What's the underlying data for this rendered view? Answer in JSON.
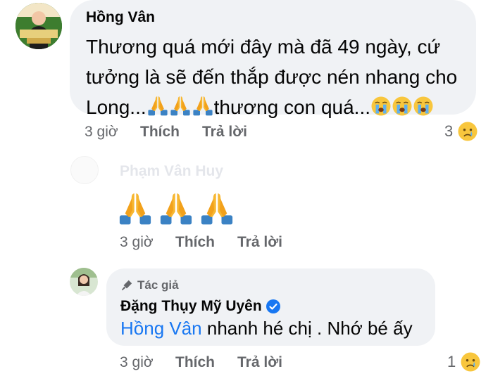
{
  "comments": [
    {
      "author": "Hồng Vân",
      "text_parts": [
        "Thương quá mới đây mà đã 49 ngày, cứ",
        "tưởng là sẽ đến thắp được nén nhang cho",
        "Long...",
        "thương con quá..."
      ],
      "time": "3 giờ",
      "like_label": "Thích",
      "reply_label": "Trả lời",
      "reaction_count": "3",
      "reaction_icon": "sad-face-icon"
    },
    {
      "author": "Phạm Vân Huy",
      "text": "",
      "emojis": [
        "folded-hands-icon",
        "folded-hands-icon",
        "folded-hands-icon"
      ],
      "time": "3 giờ",
      "like_label": "Thích",
      "reply_label": "Trả lời"
    },
    {
      "badge": "Tác giả",
      "author": "Đặng Thụy Mỹ Uyên",
      "verified": true,
      "mention": "Hồng Vân",
      "text": " nhanh hé chị . Nhớ bé ấy",
      "time": "3 giờ",
      "like_label": "Thích",
      "reply_label": "Trả lời",
      "reaction_count": "1",
      "reaction_icon": "sad-face-icon"
    }
  ],
  "colors": {
    "bubble": "#f0f2f5",
    "secondary_text": "#65676b",
    "mention": "#1877f2",
    "verified": "#1877f2"
  }
}
